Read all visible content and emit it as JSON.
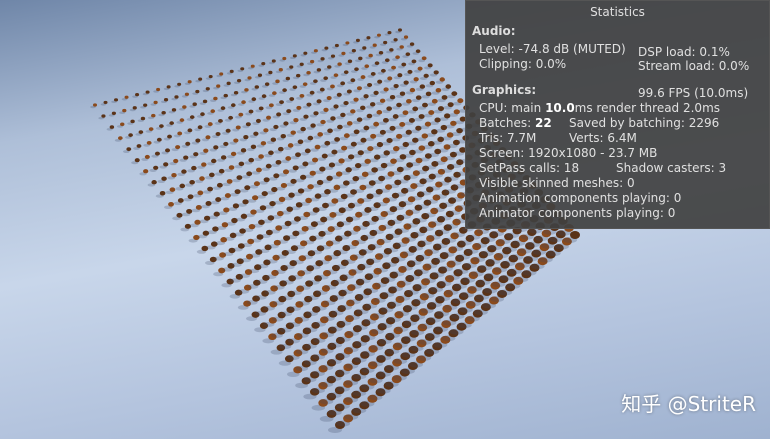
{
  "stats": {
    "title": "Statistics",
    "audio_header": "Audio:",
    "level": "Level: -74.8 dB (MUTED)",
    "clipping": "Clipping: 0.0%",
    "dsp": "DSP load: 0.1%",
    "stream": "Stream load: 0.0%",
    "graphics_header": "Graphics:",
    "fps": "99.6 FPS (10.0ms)",
    "cpu_prefix": "CPU: main ",
    "cpu_main": "10.0",
    "cpu_suffix": "ms  render thread 2.0ms",
    "batches_prefix": "Batches: ",
    "batches": "22",
    "saved": "Saved by batching: 2296",
    "tris": "Tris: 7.7M",
    "verts": "Verts: 6.4M",
    "screen": "Screen: 1920x1080 - 23.7 MB",
    "setpass": "SetPass calls: 18",
    "shadow": "Shadow casters: 3",
    "skinned": "Visible skinned meshes: 0",
    "animation": "Animation components playing: 0",
    "animator": "Animator components playing: 0"
  },
  "watermark": "知乎 @StriteR"
}
